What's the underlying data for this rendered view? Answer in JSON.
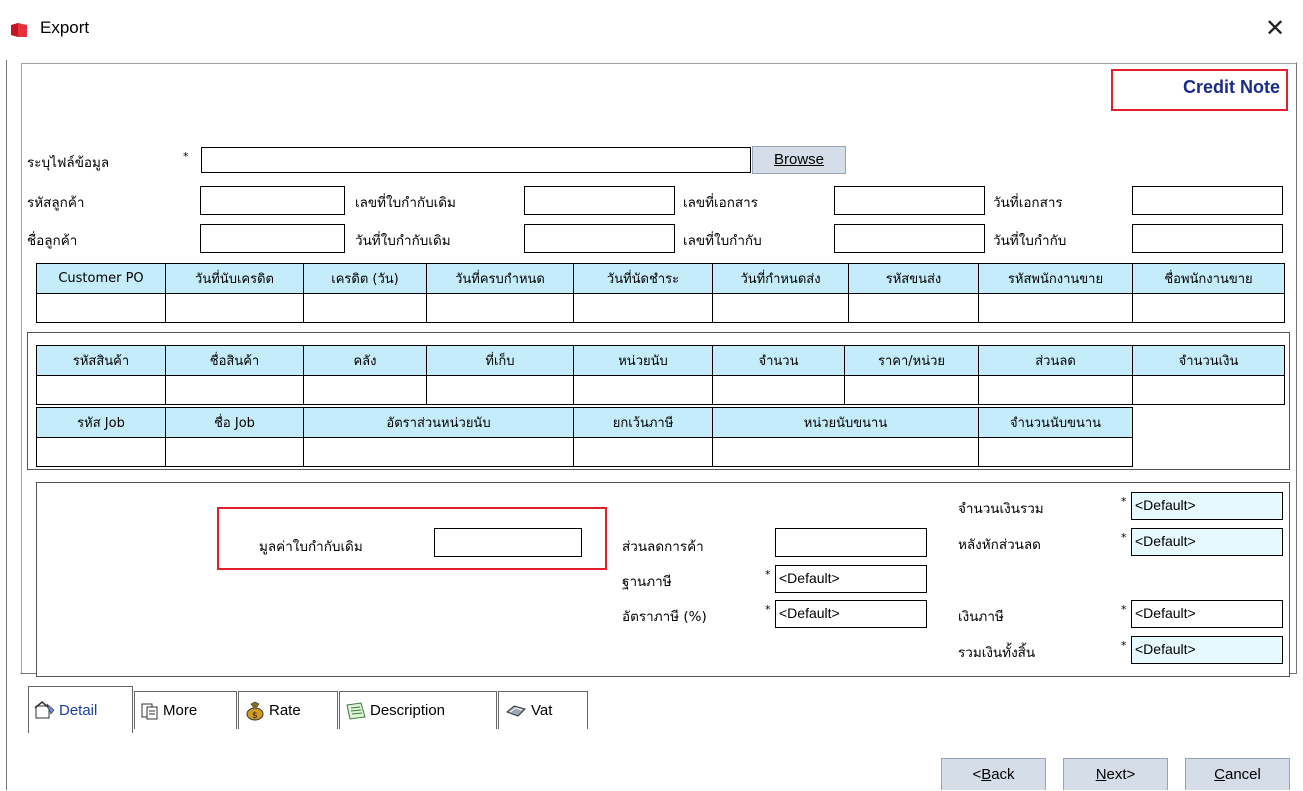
{
  "window": {
    "title": "Export"
  },
  "header": {
    "credit_note": "Credit Note"
  },
  "file": {
    "label": "ระบุไฟล์ข้อมูล",
    "required": "*",
    "value": "",
    "browse": "Browse"
  },
  "info": {
    "customer_code": "รหัสลูกค้า",
    "orig_tax_invoice_no": "เลขที่ใบกำกับเดิม",
    "doc_no": "เลขที่เอกสาร",
    "doc_date": "วันที่เอกสาร",
    "customer_name": "ชื่อลูกค้า",
    "orig_tax_invoice_date": "วันที่ใบกำกับเดิม",
    "tax_invoice_no": "เลขที่ใบกำกับ",
    "tax_invoice_date": "วันที่ใบกำกับ"
  },
  "header_grid": {
    "columns": [
      "Customer PO",
      "วันที่นับเครดิต",
      "เครดิต (วัน)",
      "วันที่ครบกำหนด",
      "วันที่นัดชำระ",
      "วันที่กำหนดส่ง",
      "รหัสขนส่ง",
      "รหัสพนักงานขาย",
      "ชื่อพนักงานขาย"
    ]
  },
  "item_grid": {
    "columns": [
      "รหัสสินค้า",
      "ชื่อสินค้า",
      "คลัง",
      "ที่เก็บ",
      "หน่วยนับ",
      "จำนวน",
      "ราคา/หน่วย",
      "ส่วนลด",
      "จำนวนเงิน"
    ],
    "columns2": [
      "รหัส Job",
      "ชื่อ Job",
      "อัตราส่วนหน่วยนับ",
      "ยกเว้นภาษี",
      "หน่วยนับขนาน",
      "จำนวนนับขนาน"
    ]
  },
  "totals": {
    "orig_value": "มูลค่าใบกำกับเดิม",
    "trade_discount": "ส่วนลดการค้า",
    "tax_base": "ฐานภาษี",
    "tax_rate": "อัตราภาษี (%)",
    "total_amount": "จำนวนเงินรวม",
    "after_discount": "หลังหักส่วนลด",
    "tax_amount": "เงินภาษี",
    "grand_total": "รวมเงินทั้งสิ้น",
    "star": "*",
    "default": "<Default>"
  },
  "tabs": [
    {
      "label": "Detail",
      "icon": "detail-icon"
    },
    {
      "label": "More",
      "icon": "more-icon"
    },
    {
      "label": "Rate",
      "icon": "rate-icon"
    },
    {
      "label": "Description",
      "icon": "description-icon"
    },
    {
      "label": "Vat",
      "icon": "vat-icon"
    }
  ],
  "nav": {
    "back_underlined": "B",
    "back_prefix": "<",
    "back_suffix": "ack",
    "next_underlined": "N",
    "next_suffix": "ext>",
    "cancel_underlined": "C",
    "cancel_suffix": "ancel"
  },
  "colors": {
    "accent_red": "#e3202b",
    "title_blue": "#1a2b8a",
    "header_cell": "#c5ecfa",
    "default_field": "#e6f9ff"
  }
}
